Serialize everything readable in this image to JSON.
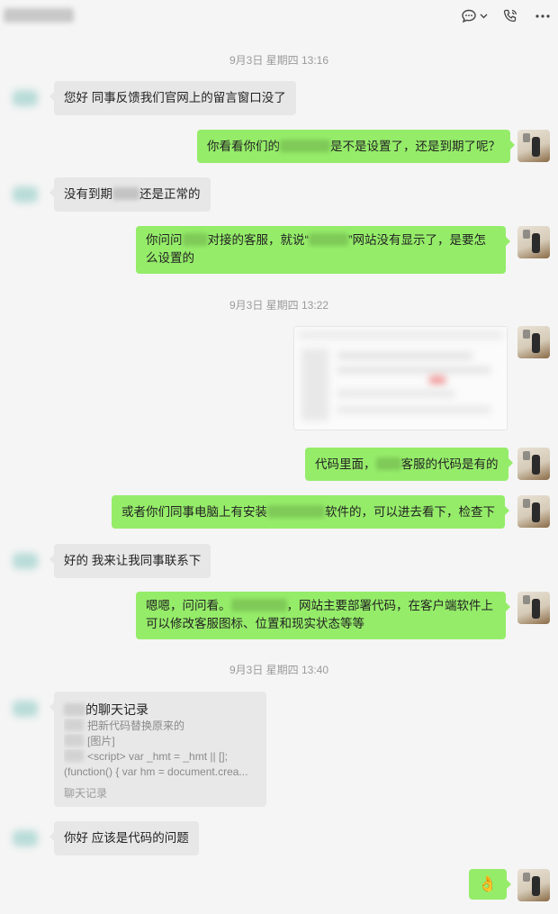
{
  "header": {
    "chat_icon": "chat-bubble-icon",
    "chevron_icon": "chevron-down-icon",
    "call_icon": "phone-call-icon",
    "more_icon": "more-icon"
  },
  "timestamps": {
    "t1": "9月3日 星期四 13:16",
    "t2": "9月3日 星期四 13:22",
    "t3": "9月3日 星期四 13:40"
  },
  "messages": {
    "m1": "您好 同事反馈我们官网上的留言窗口没了",
    "m2_a": "你看看你们的",
    "m2_b": "是不是设置了，还是到期了呢？",
    "m3_a": "没有到期",
    "m3_b": "还是正常的",
    "m4_a": "你问问",
    "m4_b": "对接的客服，就说“",
    "m4_c": "”网站没有显示了，是要怎么设置的",
    "m5_a": "代码里面，",
    "m5_b": "客服的代码是有的",
    "m6_a": "或者你们同事电脑上有安装",
    "m6_b": "软件的，可以进去看下，检查下",
    "m7": "好的 我来让我同事联系下",
    "m8_a": "嗯嗯，问问看。",
    "m8_b": "，网站主要部署代码，在客户端软件上可以修改客服图标、位置和现实状态等等",
    "m9": "你好 应该是代码的问题",
    "m10_emoji": "👌"
  },
  "chat_record": {
    "title_suffix": "的聊天记录",
    "line1": "把新代码替换原来的",
    "line2": "[图片]",
    "line3": "<script> var _hmt = _hmt || [];",
    "line4": "(function() { var hm = document.crea...",
    "footer": "聊天记录"
  },
  "colors": {
    "background": "#f5f5f5",
    "self_bubble": "#95ec69",
    "other_bubble": "#e7e7e7",
    "timestamp": "#9a9a9a"
  }
}
